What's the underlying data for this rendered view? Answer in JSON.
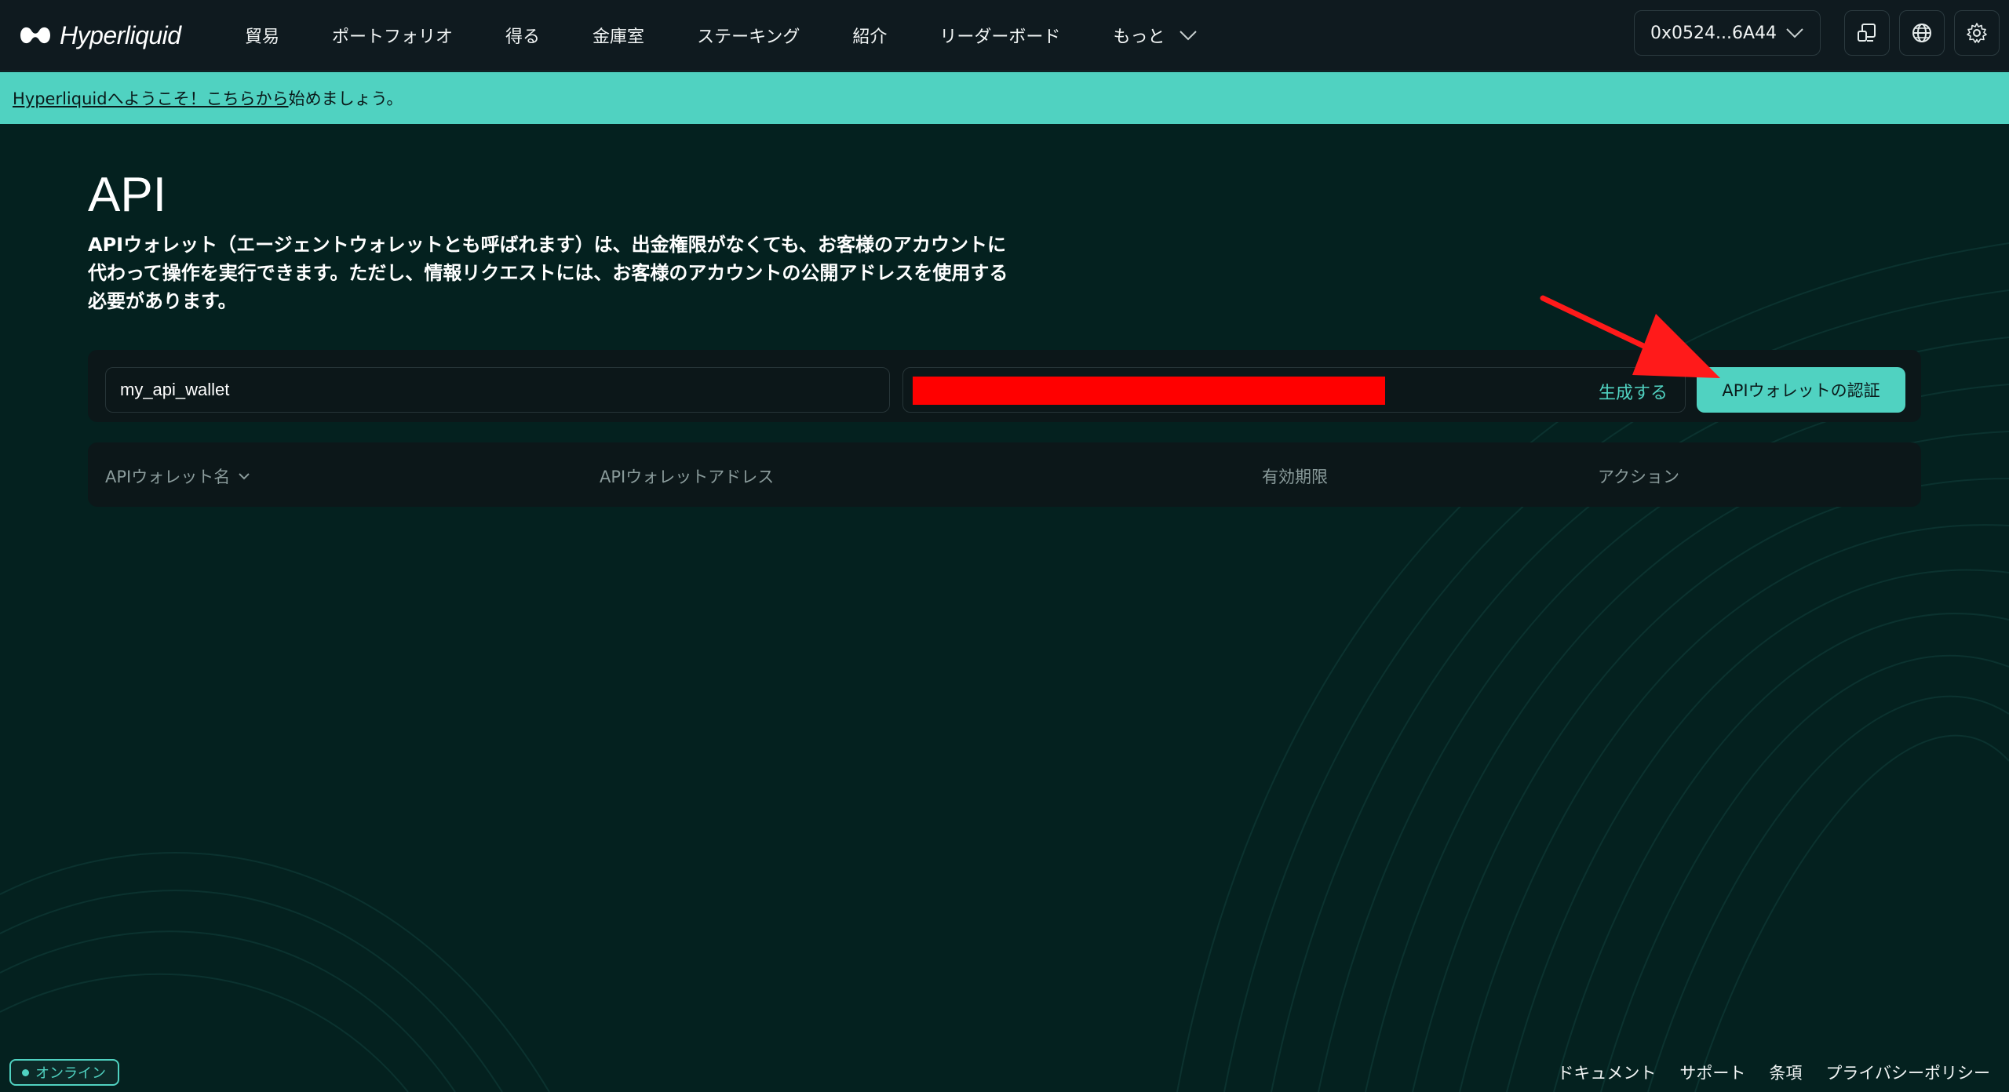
{
  "app": {
    "name": "Hyperliquid"
  },
  "nav": {
    "items": [
      "貿易",
      "ポートフォリオ",
      "得る",
      "金庫室",
      "ステーキング",
      "紹介",
      "リーダーボード"
    ],
    "more_label": "もっと"
  },
  "wallet": {
    "address": "0x0524...6A44"
  },
  "icons": {
    "logo": "hyperliquid-logo",
    "more": "chevron-down-icon",
    "wallet_dropdown": "chevron-down-icon",
    "device": "device-icon",
    "language": "globe-icon",
    "settings": "gear-icon"
  },
  "banner": {
    "link_text": "Hyperliquidへようこそ！こちらから",
    "rest_text": "始めましょう。"
  },
  "page": {
    "title": "API",
    "description": "APIウォレット（エージェントウォレットとも呼ばれます）は、出金権限がなくても、お客様のアカウントに代わって操作を実行できます。ただし、情報リクエストには、お客様のアカウントの公開アドレスを使用する必要があります。"
  },
  "form": {
    "name_value": "my_api_wallet",
    "generate_label": "生成する",
    "authorize_label": "APIウォレットの認証"
  },
  "table": {
    "columns": [
      "APIウォレット名",
      "APIウォレットアドレス",
      "有効期限",
      "アクション"
    ]
  },
  "footer": {
    "status": "オンライン",
    "links": [
      "ドキュメント",
      "サポート",
      "条項",
      "プライバシーポリシー"
    ]
  },
  "colors": {
    "accent": "#50d2c1",
    "background": "#04211f",
    "nav_background": "#0f1a1f",
    "redaction": "#ff0000",
    "arrow": "#ff1a1a"
  }
}
